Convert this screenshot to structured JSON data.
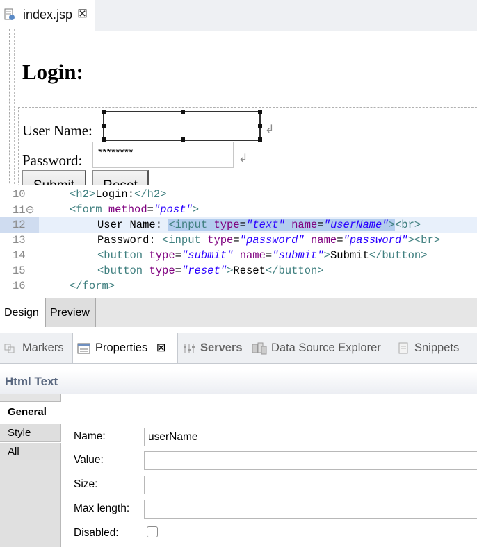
{
  "editor": {
    "tab_label": "index.jsp",
    "tab_close": "⊠"
  },
  "design": {
    "heading": "Login:",
    "username_label": "User Name:",
    "password_label": "Password:",
    "password_value": "********",
    "break_glyph": "↲",
    "submit_label": "Submit",
    "reset_label": "Reset"
  },
  "source": {
    "lines": [
      {
        "num": "10",
        "code": "<h2>Login:</h2>"
      },
      {
        "num": "11⊖",
        "code": "<form method=\"post\">"
      },
      {
        "num": "12",
        "code": "User Name: <input type=\"text\" name=\"userName\"><br>"
      },
      {
        "num": "13",
        "code": "Password: <input type=\"password\" name=\"password\"><br>"
      },
      {
        "num": "14",
        "code": "<button type=\"submit\" name=\"submit\">Submit</button>"
      },
      {
        "num": "15",
        "code": "<button type=\"reset\">Reset</button>"
      },
      {
        "num": "16",
        "code": "</form>"
      }
    ]
  },
  "mode_tabs": {
    "design": "Design",
    "preview": "Preview"
  },
  "views": {
    "markers": "Markers",
    "properties": "Properties",
    "properties_close": "⊠",
    "servers": "Servers",
    "data_source_explorer": "Data Source Explorer",
    "snippets": "Snippets"
  },
  "properties": {
    "title": "Html Text",
    "sections": {
      "general": "General",
      "style": "Style",
      "all": "All"
    },
    "fields": {
      "name_label": "Name:",
      "name_value": "userName",
      "value_label": "Value:",
      "value_value": "",
      "size_label": "Size:",
      "size_value": "",
      "max_length_label": "Max length:",
      "max_length_value": "",
      "disabled_label": "Disabled:"
    }
  },
  "colors": {
    "tag": "#3f7f7f",
    "attribute": "#7f007f",
    "value": "#2a00ff",
    "selection": "#b3cdee",
    "properties_title": "#59677f"
  }
}
